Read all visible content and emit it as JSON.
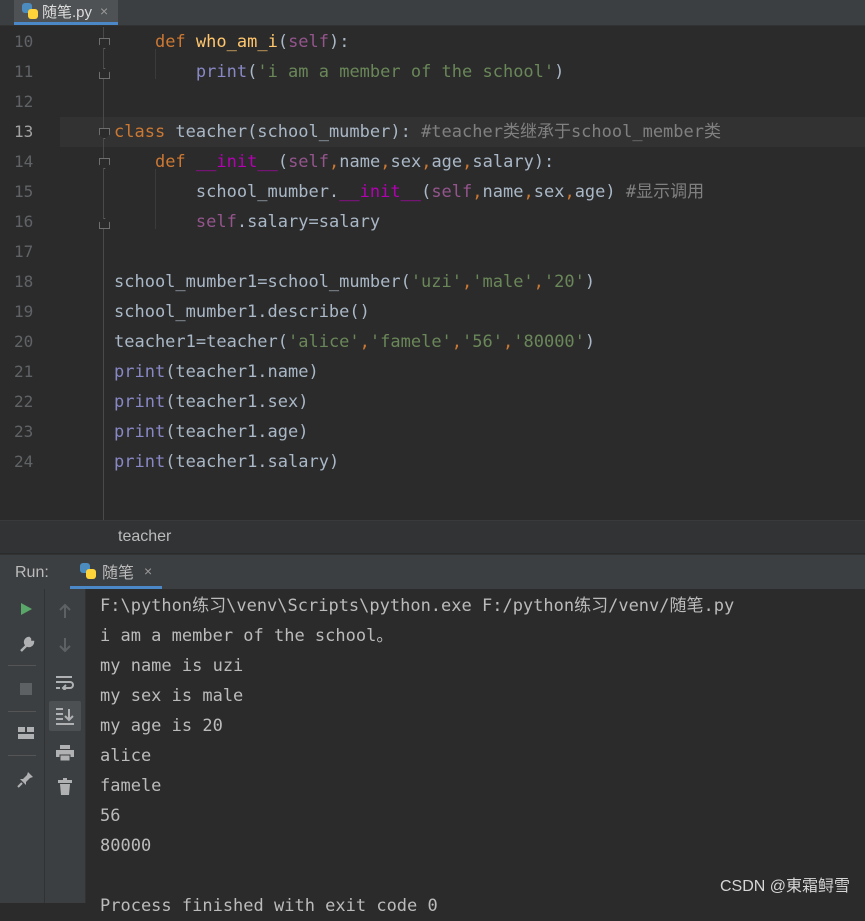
{
  "tab": {
    "title": "随笔.py",
    "close": "×"
  },
  "editor": {
    "line_numbers": [
      "10",
      "11",
      "12",
      "13",
      "14",
      "15",
      "16",
      "17",
      "18",
      "19",
      "20",
      "21",
      "22",
      "23",
      "24"
    ],
    "breadcrumb": "teacher"
  },
  "run": {
    "label": "Run:",
    "tab_title": "随笔",
    "tab_close": "×",
    "output": [
      "F:\\python练习\\venv\\Scripts\\python.exe F:/python练习/venv/随笔.py",
      "i am a member of the school。",
      "my name is uzi",
      "my sex is male",
      "my age is 20",
      "alice",
      "famele",
      "56",
      "80000",
      "",
      "Process finished with exit code 0"
    ]
  },
  "watermark": "CSDN @東霜鲟雪",
  "colors": {
    "keyword": "#cc7832",
    "function": "#ffc66d",
    "self": "#94558d",
    "builtin": "#8888c6",
    "string": "#6a8759",
    "comment": "#808080",
    "accent": "#4a88c7"
  }
}
